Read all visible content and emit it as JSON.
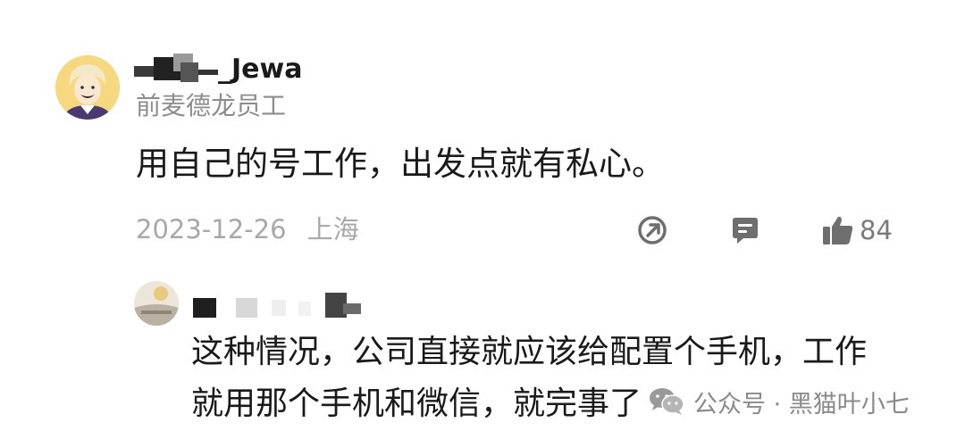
{
  "comment": {
    "user": {
      "name": "_Jewa",
      "title": "前麦德龙员工"
    },
    "text": "用自己的号工作，出发点就有私心。",
    "date": "2023-12-26",
    "location": "上海",
    "actions": {
      "share_icon": "share-icon",
      "reply_icon": "reply-icon",
      "like_icon": "thumbs-up-icon",
      "like_count": "84"
    },
    "colors": {
      "text": "#1a1a1a",
      "secondary": "#8c8c8c",
      "meta": "#a8a8a8",
      "icon": "#6e6e6e"
    }
  },
  "reply": {
    "lines": [
      "这种情况，公司直接就应该给配置个手机，工作",
      "就用那个手机和微信，就完事了"
    ]
  },
  "watermark": {
    "icon": "wechat-icon",
    "text": "公众号 · 黑猫叶小七"
  }
}
